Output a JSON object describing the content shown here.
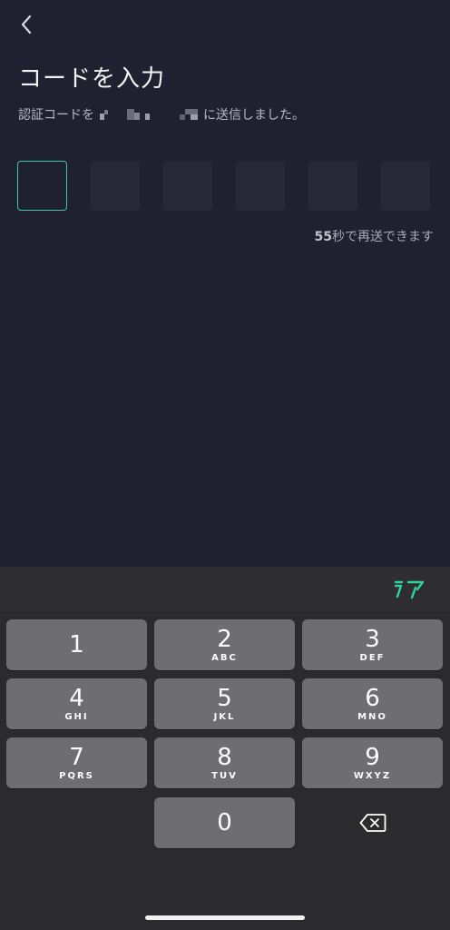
{
  "header": {
    "title": "コードを入力",
    "subtitle_prefix": "認証コードを",
    "subtitle_suffix": "に送信しました。"
  },
  "code": {
    "length": 6,
    "active_index": 0
  },
  "resend": {
    "seconds": "55",
    "text": "秒で再送できます"
  },
  "keyboard": {
    "keys": [
      {
        "num": "1",
        "letters": ""
      },
      {
        "num": "2",
        "letters": "ABC"
      },
      {
        "num": "3",
        "letters": "DEF"
      },
      {
        "num": "4",
        "letters": "GHI"
      },
      {
        "num": "5",
        "letters": "JKL"
      },
      {
        "num": "6",
        "letters": "MNO"
      },
      {
        "num": "7",
        "letters": "PQRS"
      },
      {
        "num": "8",
        "letters": "TUV"
      },
      {
        "num": "9",
        "letters": "WXYZ"
      },
      {
        "num": "0",
        "letters": ""
      }
    ],
    "logo_icon": "app-logo-icon",
    "accent_color": "#2fd39a"
  },
  "colors": {
    "background": "#1f2130",
    "active_border": "#3ec8a4",
    "key": "#6d6d72"
  }
}
